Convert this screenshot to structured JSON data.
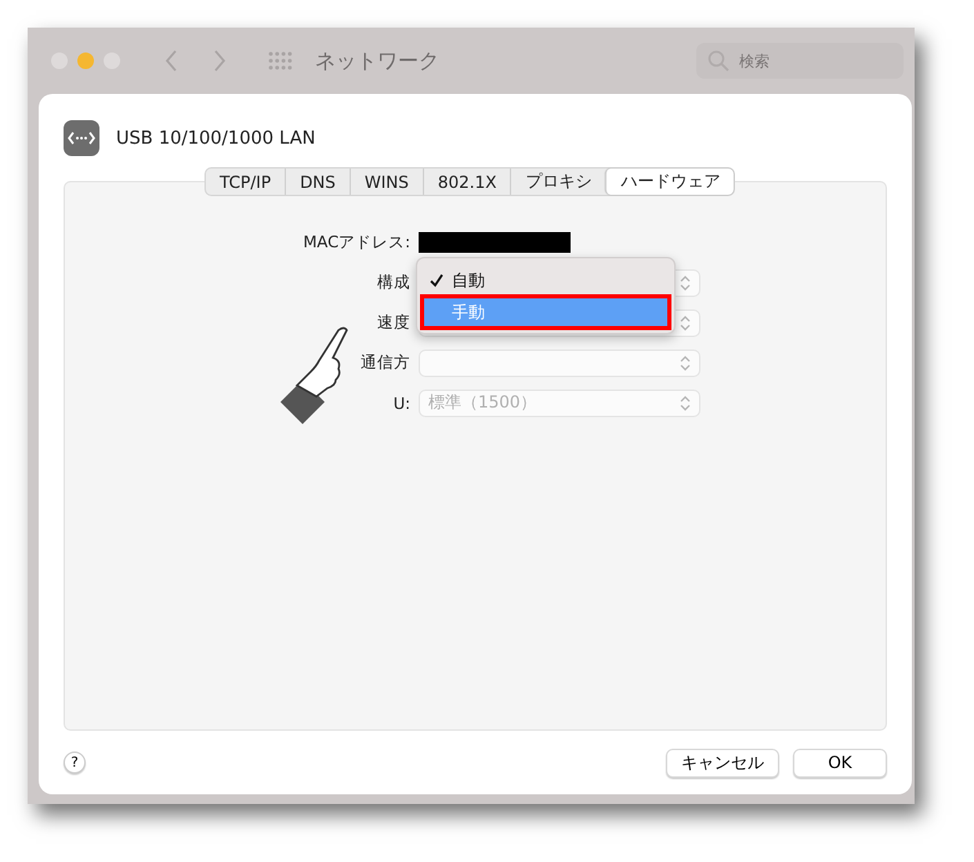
{
  "window": {
    "title": "ネットワーク",
    "search": {
      "placeholder": "検索"
    }
  },
  "sheet": {
    "device": "USB 10/100/1000 LAN",
    "tabs": [
      {
        "label": "TCP/IP",
        "selected": false
      },
      {
        "label": "DNS",
        "selected": false
      },
      {
        "label": "WINS",
        "selected": false
      },
      {
        "label": "802.1X",
        "selected": false
      },
      {
        "label": "プロキシ",
        "selected": false
      },
      {
        "label": "ハードウェア",
        "selected": true
      }
    ],
    "fields": [
      {
        "label": "MACアドレス:",
        "kind": "redacted"
      },
      {
        "label": "構成",
        "kind": "popup"
      },
      {
        "label": "速度",
        "kind": "popup"
      },
      {
        "label": "通信方",
        "kind": "popup"
      },
      {
        "label": "U:",
        "kind": "popup",
        "value": "標準（1500）"
      }
    ],
    "menu": {
      "items": [
        {
          "label": "自動",
          "checked": true,
          "selected": false
        },
        {
          "label": "手動",
          "checked": false,
          "selected": true
        }
      ]
    },
    "help": "?",
    "buttons": [
      "キャンセル",
      "OK"
    ]
  }
}
